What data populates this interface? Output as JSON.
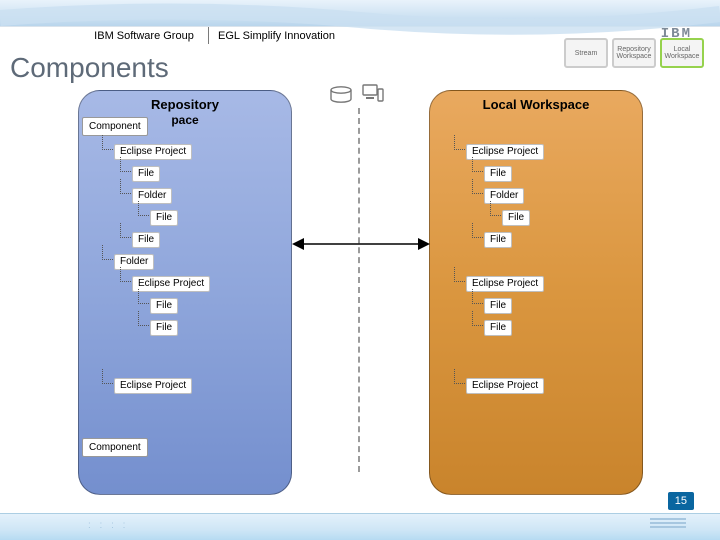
{
  "header": {
    "group": "IBM Software Group",
    "subtitle": "EGL Simplify Innovation",
    "logo": "IBM"
  },
  "thumbs": {
    "a": "Stream",
    "b": "Repository Workspace",
    "c": "Local Workspace"
  },
  "title": "Components",
  "left_panel": {
    "title": "Repository",
    "subtitle": "pace"
  },
  "right_panel": {
    "title": "Local Workspace"
  },
  "labels": {
    "component": "Component",
    "eclipse_project": "Eclipse Project",
    "file": "File",
    "folder": "Folder"
  },
  "page_number": "15"
}
